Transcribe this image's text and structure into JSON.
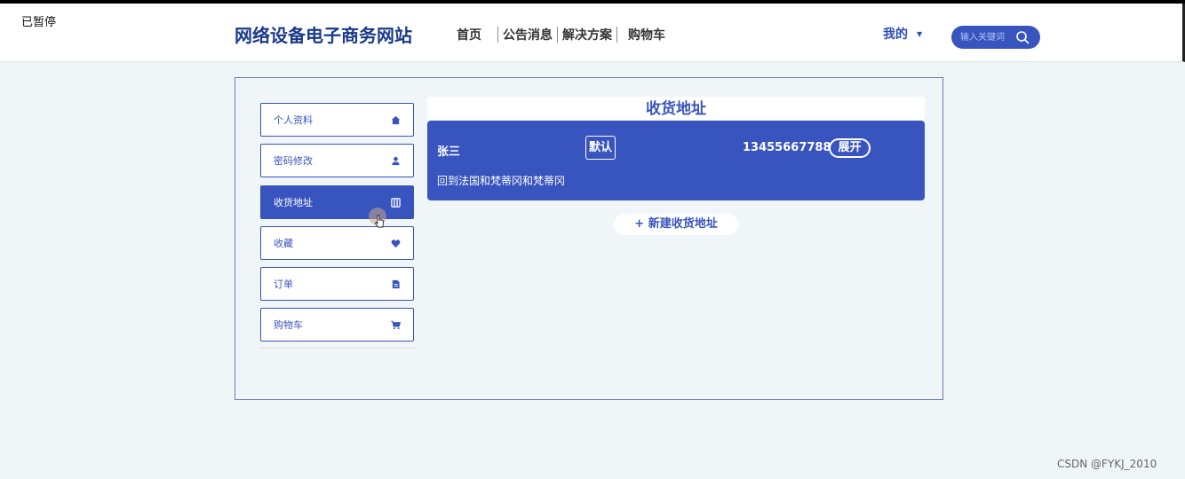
{
  "corner_mark": "已暂停",
  "header": {
    "site_title": "网络设备电子商务网站",
    "nav": [
      "首页",
      "公告消息",
      "解决方案",
      "购物车"
    ],
    "me_label": "我的",
    "search_placeholder": "输入关键词"
  },
  "sidebar": {
    "items": [
      {
        "label": "个人资料",
        "icon": "home-icon"
      },
      {
        "label": "密码修改",
        "icon": "user-icon"
      },
      {
        "label": "收货地址",
        "icon": "map-icon",
        "active": true
      },
      {
        "label": "收藏",
        "icon": "heart-icon"
      },
      {
        "label": "订单",
        "icon": "document-icon"
      },
      {
        "label": "购物车",
        "icon": "cart-icon"
      }
    ]
  },
  "main": {
    "title": "收货地址",
    "address": {
      "name": "张三",
      "default_label": "默认",
      "phone": "13455667788",
      "expand_label": "展开",
      "detail": "回到法国和梵蒂冈和梵蒂冈"
    },
    "new_address_label": "+ 新建收货地址"
  },
  "watermark": "CSDN @FYKJ_2010",
  "colors": {
    "accent": "#3854bf",
    "title": "#1b3a8c",
    "background": "#f0f6f8"
  }
}
